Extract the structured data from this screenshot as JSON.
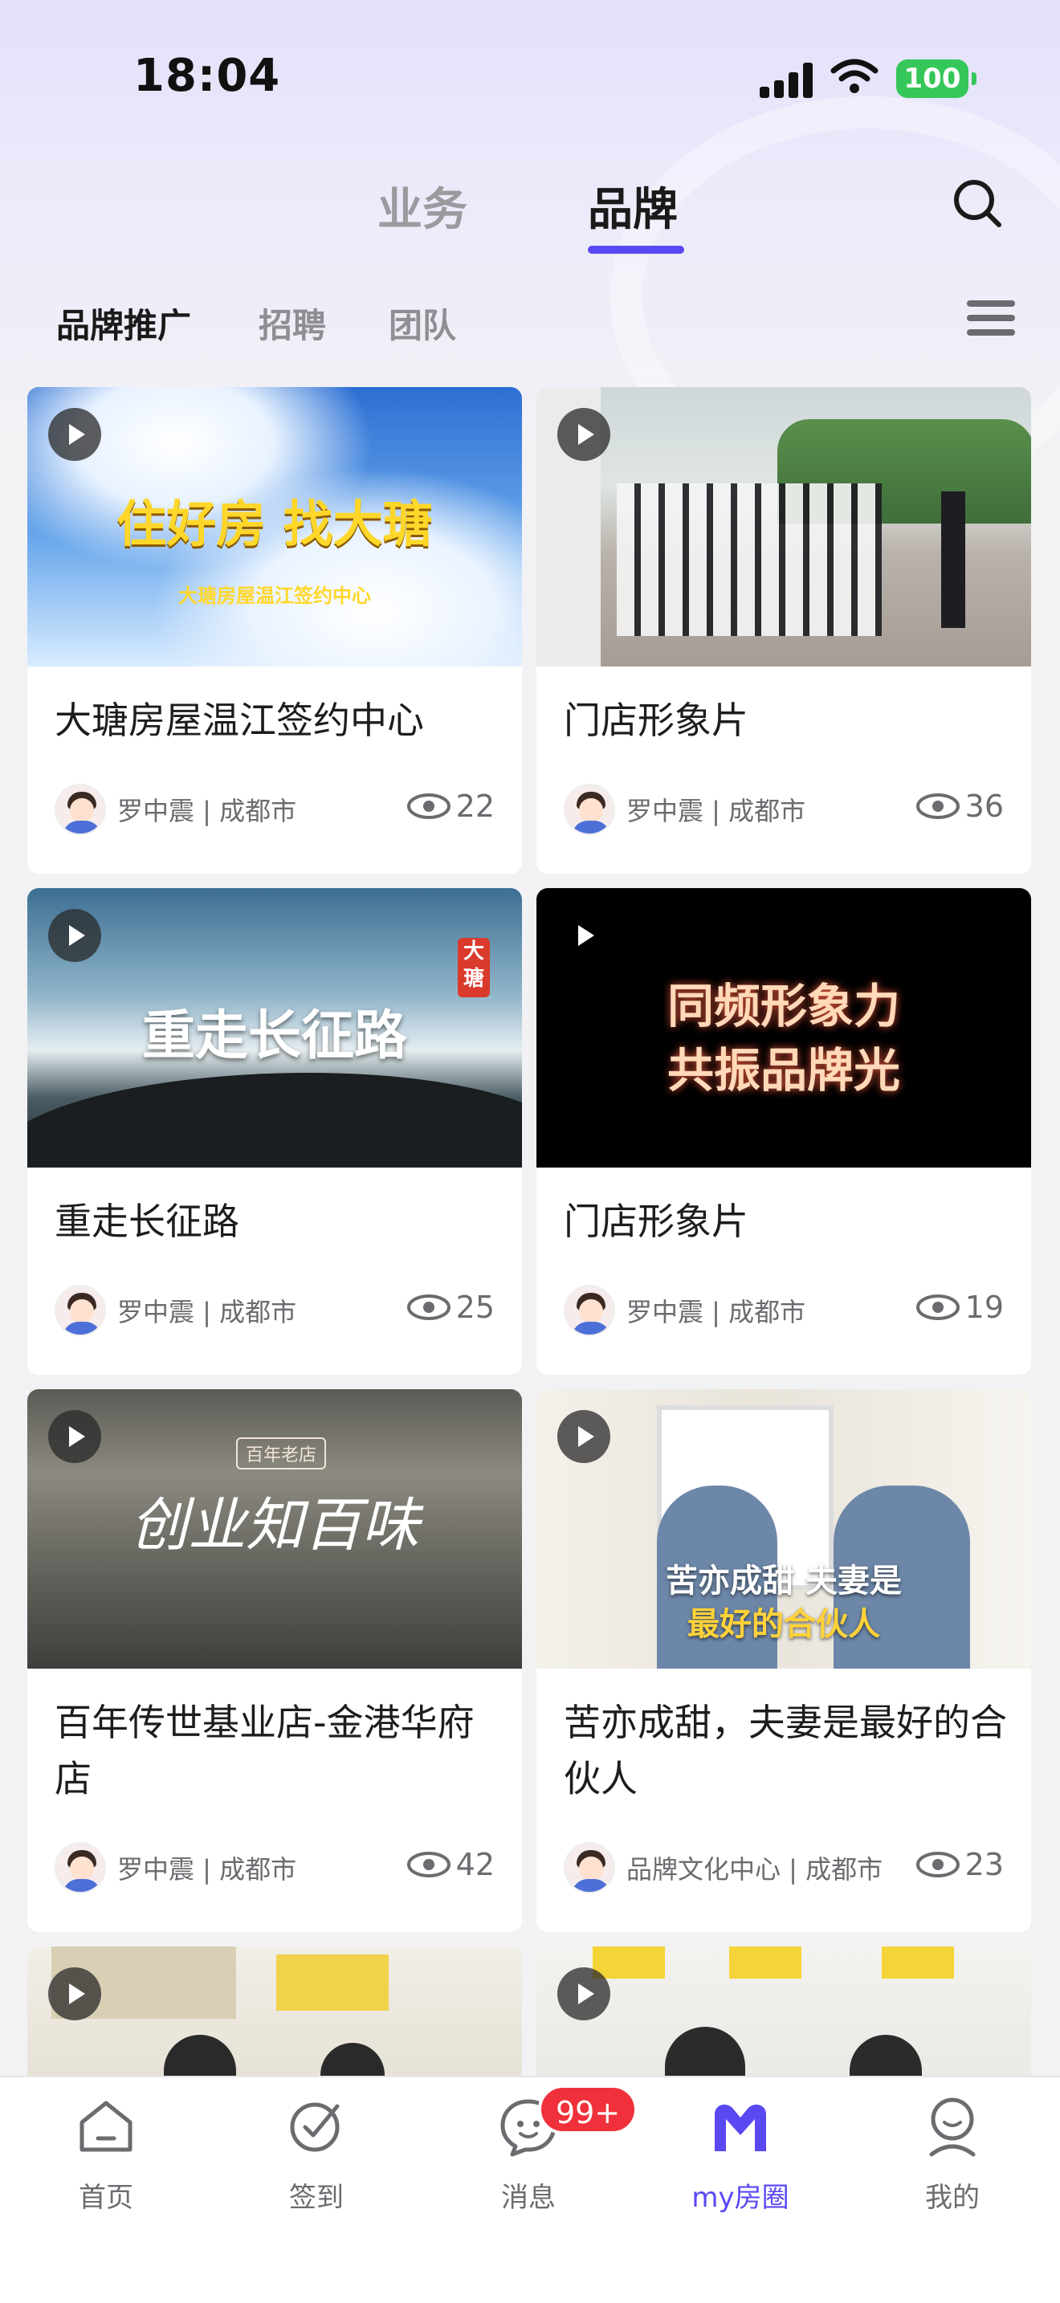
{
  "status_bar": {
    "time": "18:04",
    "battery": "100"
  },
  "header": {
    "tabs": [
      {
        "label": "业务"
      },
      {
        "label": "品牌"
      }
    ],
    "active_tab": "品牌"
  },
  "sub_tabs": [
    {
      "label": "品牌推广"
    },
    {
      "label": "招聘"
    },
    {
      "label": "团队"
    }
  ],
  "cards": [
    {
      "title": "大瑭房屋温江签约中心",
      "author": "罗中震",
      "city": "成都市",
      "author_line": "罗中震 | 成都市",
      "views": "22",
      "thumb_text": "住好房 找大瑭",
      "thumb_sub": "大瑭房屋温江签约中心"
    },
    {
      "title": "门店形象片",
      "author": "罗中震",
      "city": "成都市",
      "author_line": "罗中震 | 成都市",
      "views": "36",
      "thumb_text": "",
      "thumb_sub": ""
    },
    {
      "title": "重走长征路",
      "author": "罗中震",
      "city": "成都市",
      "author_line": "罗中震 | 成都市",
      "views": "25",
      "thumb_text": "重走长征路",
      "thumb_sub": "大瑭"
    },
    {
      "title": "门店形象片",
      "author": "罗中震",
      "city": "成都市",
      "author_line": "罗中震 | 成都市",
      "views": "19",
      "thumb_text": "同频形象力",
      "thumb_sub": "共振品牌光"
    },
    {
      "title": "百年传世基业店-金港华府店",
      "author": "罗中震",
      "city": "成都市",
      "author_line": "罗中震 | 成都市",
      "views": "42",
      "thumb_text": "创业知百味",
      "thumb_sub": "百年老店"
    },
    {
      "title": "苦亦成甜，夫妻是最好的合伙人",
      "author": "品牌文化中心",
      "city": "成都市",
      "author_line": "品牌文化中心 | 成都市",
      "views": "23",
      "thumb_text": "苦亦成甜 夫妻是",
      "thumb_sub": "最好的合伙人"
    }
  ],
  "bottom_nav": [
    {
      "label": "首页",
      "icon": "home-icon"
    },
    {
      "label": "签到",
      "icon": "checkin-icon"
    },
    {
      "label": "消息",
      "icon": "message-icon"
    },
    {
      "label": "my房圈",
      "icon": "my-circle-icon"
    },
    {
      "label": "我的",
      "icon": "profile-icon"
    }
  ],
  "message_badge": "99+",
  "colors": {
    "accent": "#5a48f2",
    "badge": "#f0303a",
    "battery": "#35c759"
  }
}
